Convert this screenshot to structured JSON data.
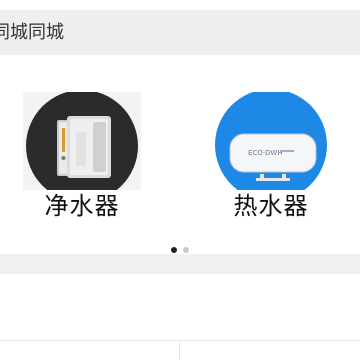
{
  "header": {
    "title": "同城同城"
  },
  "categories": [
    {
      "label": "净水器",
      "icon": "water-purifier-icon"
    },
    {
      "label": "热水器",
      "icon": "water-heater-icon"
    }
  ],
  "carousel": {
    "page_count": 2,
    "active_index": 0
  },
  "colors": {
    "header_bg": "#efefef",
    "purifier_circle": "#2b2b2b",
    "heater_circle": "#1e88e6",
    "dot_active": "#222222",
    "dot_inactive": "#c9c9c9"
  }
}
